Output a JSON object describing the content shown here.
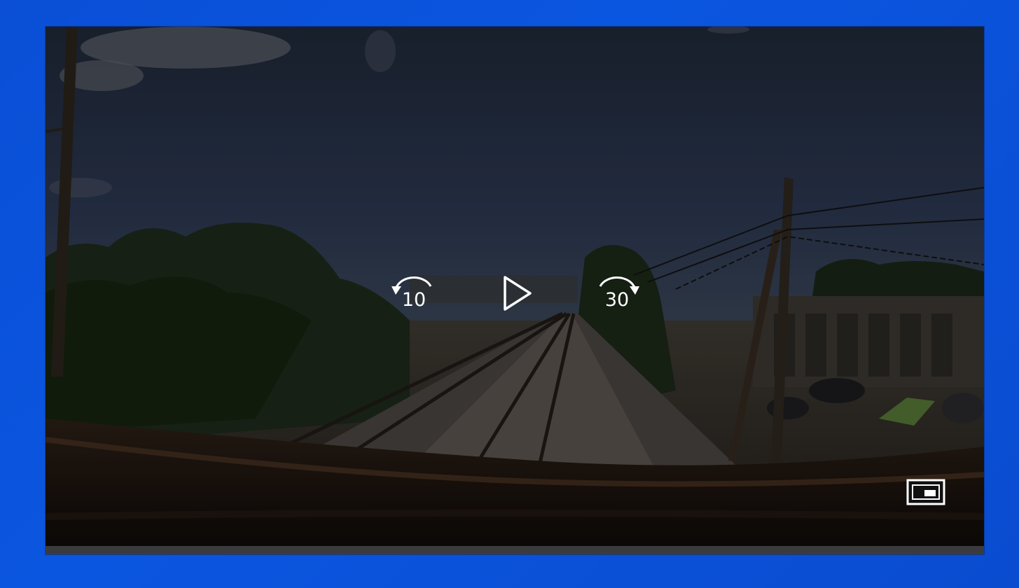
{
  "player": {
    "controls": {
      "skip_back_label": "10",
      "skip_forward_label": "30",
      "play_icon": "play-icon",
      "skip_back_icon": "rewind-arc-icon",
      "skip_forward_icon": "forward-arc-icon",
      "mini_view_icon": "compact-overlay-icon"
    },
    "progress_fraction": 0
  },
  "colors": {
    "desktop_background": "#0a4fd6",
    "control_foreground": "#ffffff",
    "progress_track": "#3b3b3d"
  }
}
